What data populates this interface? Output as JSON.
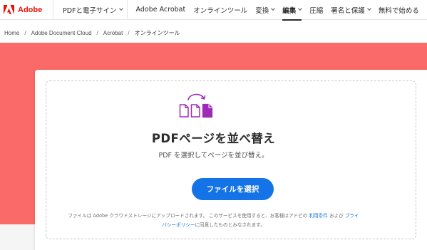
{
  "brand": {
    "name": "Adobe",
    "color": "#eb1000"
  },
  "nav": {
    "menu_label": "PDFと電子サイン",
    "items": [
      {
        "label": "Adobe Acrobat",
        "dropdown": false,
        "active": false
      },
      {
        "label": "オンラインツール",
        "dropdown": false,
        "active": false
      },
      {
        "label": "変換",
        "dropdown": true,
        "active": false
      },
      {
        "label": "編集",
        "dropdown": true,
        "active": true
      },
      {
        "label": "圧縮",
        "dropdown": false,
        "active": false
      },
      {
        "label": "署名と保護",
        "dropdown": true,
        "active": false
      },
      {
        "label": "無料で始める",
        "dropdown": false,
        "active": false
      }
    ]
  },
  "breadcrumb": {
    "items": [
      "Home",
      "Adobe Document Cloud",
      "Acrobat"
    ],
    "current": "オンラインツール"
  },
  "tool": {
    "icon": "reorder-pages-icon",
    "title": "PDFページを並べ替え",
    "subtitle": "PDF を選択してページを並び替え。",
    "button_label": "ファイルを選択"
  },
  "legal": {
    "line1_before": "ファイルは Adobe クラウドストレージにアップロードされます。 このサービスを使用すると、お客様はアドビの",
    "terms_link": "利用条件",
    "and": "および",
    "privacy_link_1": "プライ",
    "privacy_link_2": "バシーポリシー",
    "line2_after": "に同意したものとみなされます。"
  },
  "colors": {
    "hero_bg": "#fa6a68",
    "primary_button": "#1473e6",
    "icon_purple": "#9d2bb5",
    "link": "#1473e6"
  }
}
